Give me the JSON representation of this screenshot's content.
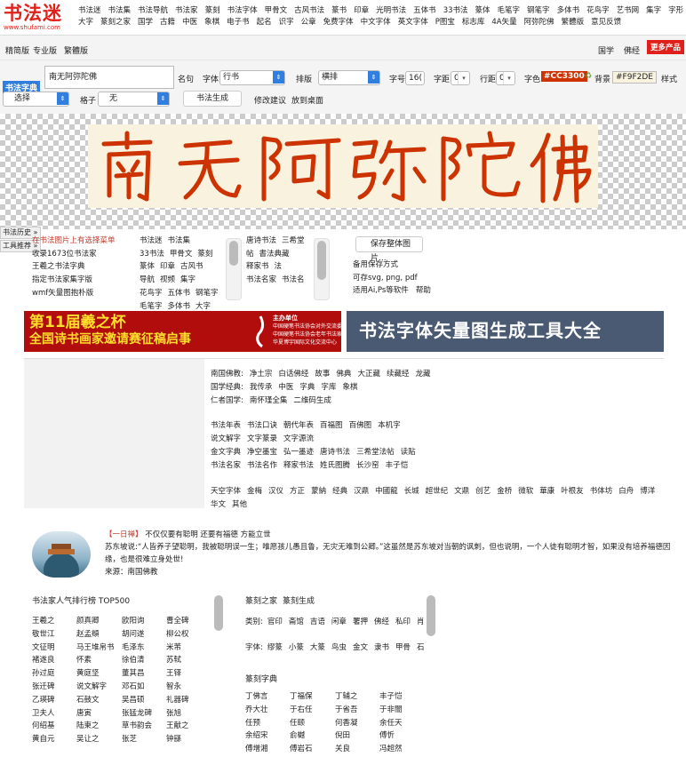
{
  "logo": {
    "name": "书法迷",
    "url": "www.shufami.com"
  },
  "nav": {
    "row1": [
      "书法迷",
      "书法集",
      "书法导航",
      "书法家",
      "篆刻",
      "书法字体",
      "甲骨文",
      "古风书法",
      "篆书",
      "印章",
      "光明书法",
      "五体书",
      "33书法",
      "篆体",
      "毛笔字",
      "钢笔字",
      "多体书",
      "花鸟字",
      "艺书网",
      "集字",
      "字形"
    ],
    "row2": [
      "大字",
      "篆刻之家",
      "国学",
      "古籍",
      "中医",
      "象棋",
      "电子书",
      "起名",
      "识字",
      "公章",
      "免费字体",
      "中文字体",
      "英文字体",
      "P图宝",
      "标志库",
      "4A矢量",
      "阿弥陀佛",
      "繁體版",
      "意见反馈"
    ]
  },
  "sub": {
    "left": [
      "精简版",
      "专业版",
      "繁體版"
    ],
    "right": [
      "国学",
      "佛经"
    ],
    "more": "更多产品"
  },
  "tool": {
    "dict_label": "书法字典",
    "text": "南无阿弥陀佛",
    "name_label": "名句",
    "font_label": "字体",
    "font_value": "行书",
    "layout_label": "排版",
    "layout_value": "横排",
    "size_label": "字号",
    "size_value": "16(",
    "spacing_label": "字距",
    "spacing_value": "0",
    "line_label": "行距",
    "line_value": "0",
    "color_label": "字色",
    "color_value": "#CC3300",
    "bg_label": "背景",
    "bg_value": "#F9F2DE",
    "style_label": "样式",
    "select_value": "选择",
    "grid_label": "格子",
    "grid_value": "无",
    "generate": "书法生成",
    "suggest": "修改建议",
    "desktop": "放到桌面"
  },
  "preview": {
    "characters": "南无阿弥陀佛"
  },
  "side": {
    "history": "书法历史 »",
    "tools": "工具推荐 »"
  },
  "links": {
    "col1": [
      "在书法图片上有选择菜单",
      "收录1673位书法家",
      "王羲之书法字典",
      "指定书法家集字版",
      "wmf矢量图抱朴版"
    ],
    "col2": [
      "书法迷",
      "书法集",
      "33书法",
      "甲骨文",
      "篆刻",
      "篆体",
      "印章",
      "古风书",
      "导航",
      "视频",
      "集字",
      "花鸟字",
      "五体书",
      "钢笔字",
      "毛笔字",
      "多体书",
      "大字"
    ],
    "col3": [
      "唐诗书法",
      "三希堂",
      "帖",
      "書法典藏",
      "释家书",
      "法",
      "书法名家",
      "书法名"
    ],
    "save_button": "保存整体图片...",
    "col4": [
      "备用保存方式",
      "可存svg, png, pdf",
      "适用Ai,Ps等软件",
      "帮助"
    ]
  },
  "banner1": {
    "line1": "第11届羲之杯",
    "line2": "全国诗书画家邀请赛征稿启事",
    "org": [
      "主办单位",
      "中国硬笔书法协会对外交流委员会",
      "中国硬笔书法协会老年书法家分会",
      "华夏博宇国际文化交流中心"
    ]
  },
  "banner2": {
    "title": "书法字体矢量图生成工具大全"
  },
  "sections": [
    [
      "南国佛教:",
      "净土宗",
      "白话佛经",
      "故事",
      "佛典",
      "大正藏",
      "续藏经",
      "龙藏"
    ],
    [
      "国学经典:",
      "我传承",
      "中医",
      "字典",
      "字库",
      "象棋"
    ],
    [
      "仁者国学:",
      "南怀瑾全集",
      "二维码生成"
    ],
    [
      "书法年表",
      "书法口诀",
      "朝代年表",
      "百福图",
      "百佛图",
      "本机字"
    ],
    [
      "说文解字",
      "文字篆录",
      "文字源流"
    ],
    [
      "金文字典",
      "净空墨宝",
      "弘一墨迹",
      "唐诗书法",
      "三希堂法帖",
      "读贴"
    ],
    [
      "书法名家",
      "书法名作",
      "释家书法",
      "姓氏图腾",
      "长沙窑",
      "丰子恺"
    ],
    [
      "天空字体",
      "金梅",
      "汉仪",
      "方正",
      "蒙納",
      "经典",
      "汉鼎",
      "中國龍",
      "长城",
      "超世纪",
      "文鼎",
      "创艺",
      "金桥",
      "微软",
      "華康",
      "叶根友",
      "书体坊",
      "白舟",
      "博洋"
    ],
    [
      "华文",
      "其他"
    ]
  ],
  "quote": {
    "tag": "【一日禅】",
    "title": "不仅仅要有聪明 还要有福德 方能立世",
    "body": "苏东坡说:“人皆养子望聪明，我被聪明误一生；唯愿孩儿愚且鲁，无灾无难到公卿。”这虽然是苏东坡对当朝的讽刺，但也说明，一个人徒有聪明才智，如果没有培养福德因缘，也是很难立身处世!",
    "source": "来源：南国佛教"
  },
  "ranking": {
    "title": "书法家人气排行榜 TOP500",
    "names": [
      "王羲之",
      "颜真卿",
      "欧阳询",
      "曹全碑",
      "敬世江",
      "赵孟頫",
      "胡问遂",
      "柳公权",
      "文征明",
      "马王堆帛书",
      "毛泽东",
      "米芾",
      "褚遂良",
      "怀素",
      "徐伯清",
      "苏轼",
      "孙过庭",
      "黄庭坚",
      "董其昌",
      "王铎",
      "张迁碑",
      "说文解字",
      "邓石如",
      "智永",
      "乙瑛碑",
      "石鼓文",
      "吴昌硕",
      "礼器碑",
      "卫夫人",
      "唐寅",
      "张猛龙碑",
      "张旭",
      "何绍基",
      "陆柬之",
      "草书韵会",
      "王献之",
      "黄自元",
      "吴让之",
      "张芝",
      "钟繇"
    ]
  },
  "seal": {
    "title": "篆刻之家",
    "gen": "篆刻生成",
    "cat_label": "类别:",
    "cats": [
      "官印",
      "斋馆",
      "吉语",
      "闲章",
      "署押",
      "佛经",
      "私印",
      "肖形"
    ],
    "font_label": "字体:",
    "fonts": [
      "缪篆",
      "小篆",
      "大篆",
      "鸟虫",
      "金文",
      "隶书",
      "甲骨",
      "石鼓"
    ],
    "dict_title": "篆刻字典",
    "names": [
      "丁佛言",
      "丁福保",
      "丁辅之",
      "丰子恺",
      "乔大壮",
      "于右任",
      "于省吾",
      "于非闇",
      "任预",
      "任颐",
      "何香凝",
      "余任天",
      "余绍宋",
      "俞樾",
      "倪田",
      "傅忻",
      "傅增湘",
      "傅岩石",
      "关良",
      "冯超然"
    ]
  },
  "colors": {
    "brand": "#e0211b",
    "accent": "#2f7ee0",
    "ink": "#CC3300",
    "paper": "#F9F2DE"
  }
}
